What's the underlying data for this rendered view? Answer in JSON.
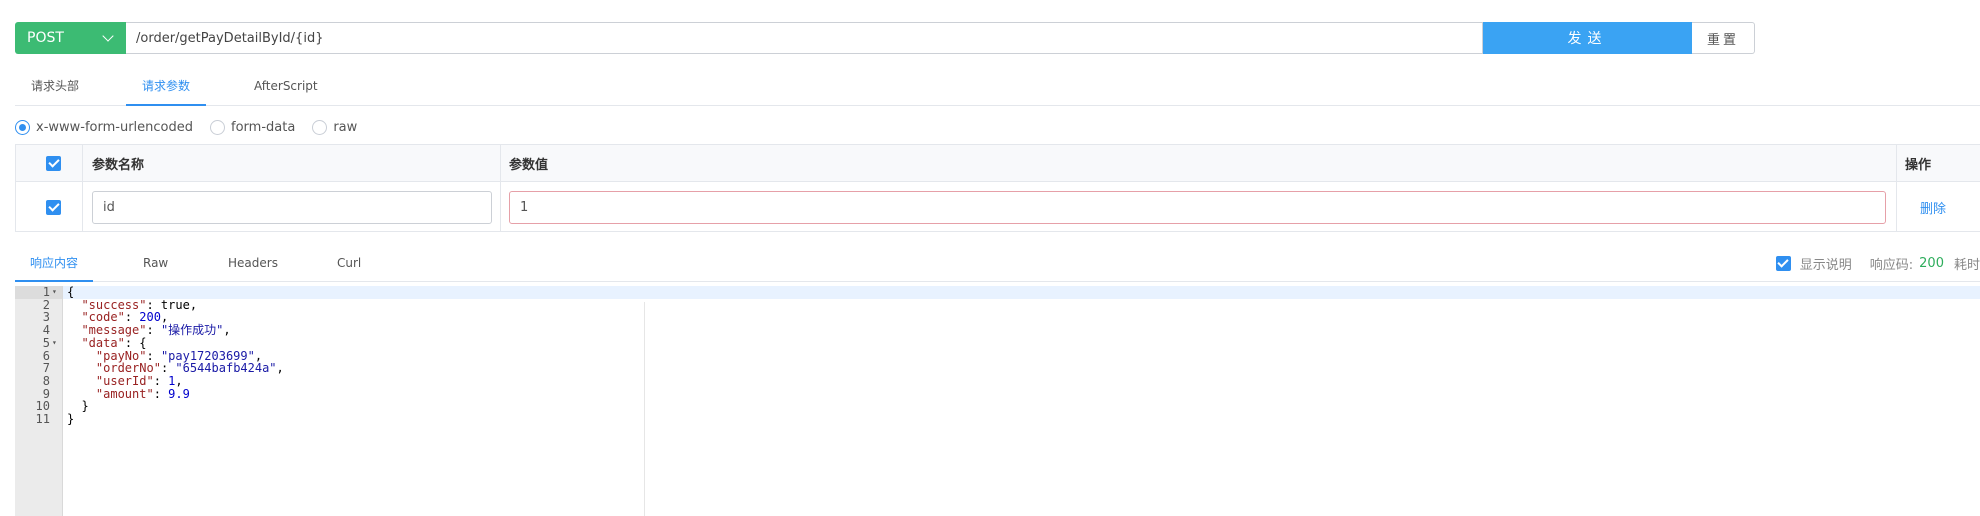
{
  "request": {
    "method": "POST",
    "url": "/order/getPayDetailById/{id}",
    "send_label": "发送",
    "reset_label": "重置"
  },
  "request_tabs": [
    {
      "label": "请求头部",
      "active": false
    },
    {
      "label": "请求参数",
      "active": true
    },
    {
      "label": "AfterScript",
      "active": false
    }
  ],
  "body_types": [
    {
      "label": "x-www-form-urlencoded",
      "selected": true
    },
    {
      "label": "form-data",
      "selected": false
    },
    {
      "label": "raw",
      "selected": false
    }
  ],
  "params_table": {
    "headers": {
      "name": "参数名称",
      "value": "参数值",
      "action": "操作"
    },
    "rows": [
      {
        "checked": true,
        "name": "id",
        "value": "1",
        "action": "删除"
      }
    ]
  },
  "response_tabs": [
    {
      "label": "响应内容",
      "active": true
    },
    {
      "label": "Raw",
      "active": false
    },
    {
      "label": "Headers",
      "active": false
    },
    {
      "label": "Curl",
      "active": false
    }
  ],
  "response_meta": {
    "show_desc_label": "显示说明",
    "show_desc_checked": true,
    "status_label": "响应码:",
    "status_code": "200",
    "time_label": "耗时"
  },
  "response_body": {
    "active_line": 1,
    "lines": [
      {
        "n": "1",
        "fold": true,
        "tokens": [
          {
            "t": "p",
            "v": "{"
          }
        ]
      },
      {
        "n": "2",
        "fold": false,
        "tokens": [
          {
            "t": "p",
            "v": "  "
          },
          {
            "t": "k",
            "v": "\"success\""
          },
          {
            "t": "p",
            "v": ": true,"
          }
        ]
      },
      {
        "n": "3",
        "fold": false,
        "tokens": [
          {
            "t": "p",
            "v": "  "
          },
          {
            "t": "k",
            "v": "\"code\""
          },
          {
            "t": "p",
            "v": ": "
          },
          {
            "t": "n",
            "v": "200"
          },
          {
            "t": "p",
            "v": ","
          }
        ]
      },
      {
        "n": "4",
        "fold": false,
        "tokens": [
          {
            "t": "p",
            "v": "  "
          },
          {
            "t": "k",
            "v": "\"message\""
          },
          {
            "t": "p",
            "v": ": "
          },
          {
            "t": "s",
            "v": "\"操作成功\""
          },
          {
            "t": "p",
            "v": ","
          }
        ]
      },
      {
        "n": "5",
        "fold": true,
        "tokens": [
          {
            "t": "p",
            "v": "  "
          },
          {
            "t": "k",
            "v": "\"data\""
          },
          {
            "t": "p",
            "v": ": {"
          }
        ]
      },
      {
        "n": "6",
        "fold": false,
        "tokens": [
          {
            "t": "p",
            "v": "    "
          },
          {
            "t": "k",
            "v": "\"payNo\""
          },
          {
            "t": "p",
            "v": ": "
          },
          {
            "t": "s",
            "v": "\"pay17203699\""
          },
          {
            "t": "p",
            "v": ","
          }
        ]
      },
      {
        "n": "7",
        "fold": false,
        "tokens": [
          {
            "t": "p",
            "v": "    "
          },
          {
            "t": "k",
            "v": "\"orderNo\""
          },
          {
            "t": "p",
            "v": ": "
          },
          {
            "t": "s",
            "v": "\"6544bafb424a\""
          },
          {
            "t": "p",
            "v": ","
          }
        ]
      },
      {
        "n": "8",
        "fold": false,
        "tokens": [
          {
            "t": "p",
            "v": "    "
          },
          {
            "t": "k",
            "v": "\"userId\""
          },
          {
            "t": "p",
            "v": ": "
          },
          {
            "t": "n",
            "v": "1"
          },
          {
            "t": "p",
            "v": ","
          }
        ]
      },
      {
        "n": "9",
        "fold": false,
        "tokens": [
          {
            "t": "p",
            "v": "    "
          },
          {
            "t": "k",
            "v": "\"amount\""
          },
          {
            "t": "p",
            "v": ": "
          },
          {
            "t": "n",
            "v": "9.9"
          }
        ]
      },
      {
        "n": "10",
        "fold": false,
        "tokens": [
          {
            "t": "p",
            "v": "  }"
          }
        ]
      },
      {
        "n": "11",
        "fold": false,
        "tokens": [
          {
            "t": "p",
            "v": "}"
          }
        ]
      }
    ]
  }
}
